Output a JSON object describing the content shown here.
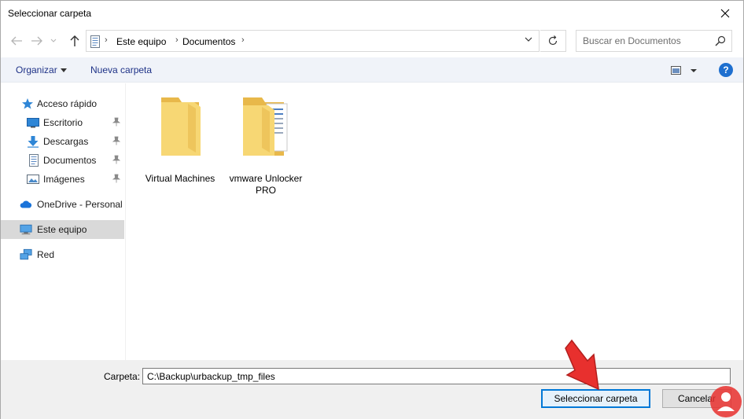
{
  "window": {
    "title": "Seleccionar carpeta"
  },
  "nav": {
    "breadcrumbs": [
      "Este equipo",
      "Documentos"
    ],
    "search_placeholder": "Buscar en Documentos"
  },
  "commands": {
    "organize_label": "Organizar",
    "new_folder_label": "Nueva carpeta",
    "help_label": "?"
  },
  "sidebar": {
    "items": [
      {
        "label": "Acceso rápido",
        "icon": "star-icon",
        "pinned": false
      },
      {
        "label": "Escritorio",
        "icon": "desktop-icon",
        "pinned": true
      },
      {
        "label": "Descargas",
        "icon": "download-icon",
        "pinned": true
      },
      {
        "label": "Documentos",
        "icon": "document-icon",
        "pinned": true
      },
      {
        "label": "Imágenes",
        "icon": "pictures-icon",
        "pinned": true
      },
      {
        "label": "OneDrive - Personal",
        "icon": "cloud-icon",
        "pinned": false
      },
      {
        "label": "Este equipo",
        "icon": "computer-icon",
        "pinned": false,
        "selected": true
      },
      {
        "label": "Red",
        "icon": "network-icon",
        "pinned": false
      }
    ]
  },
  "content": {
    "folders": [
      {
        "name": "Virtual Machines"
      },
      {
        "name": "vmware Unlocker PRO"
      }
    ]
  },
  "bottom": {
    "folder_label": "Carpeta:",
    "folder_value": "C:\\Backup\\urbackup_tmp_files",
    "select_button": "Seleccionar carpeta",
    "cancel_button": "Cancelar"
  },
  "colors": {
    "accent": "#0078d7",
    "command_text": "#1e3287",
    "folder_yellow": "#f7d774",
    "annotation_red": "#e8302e"
  }
}
